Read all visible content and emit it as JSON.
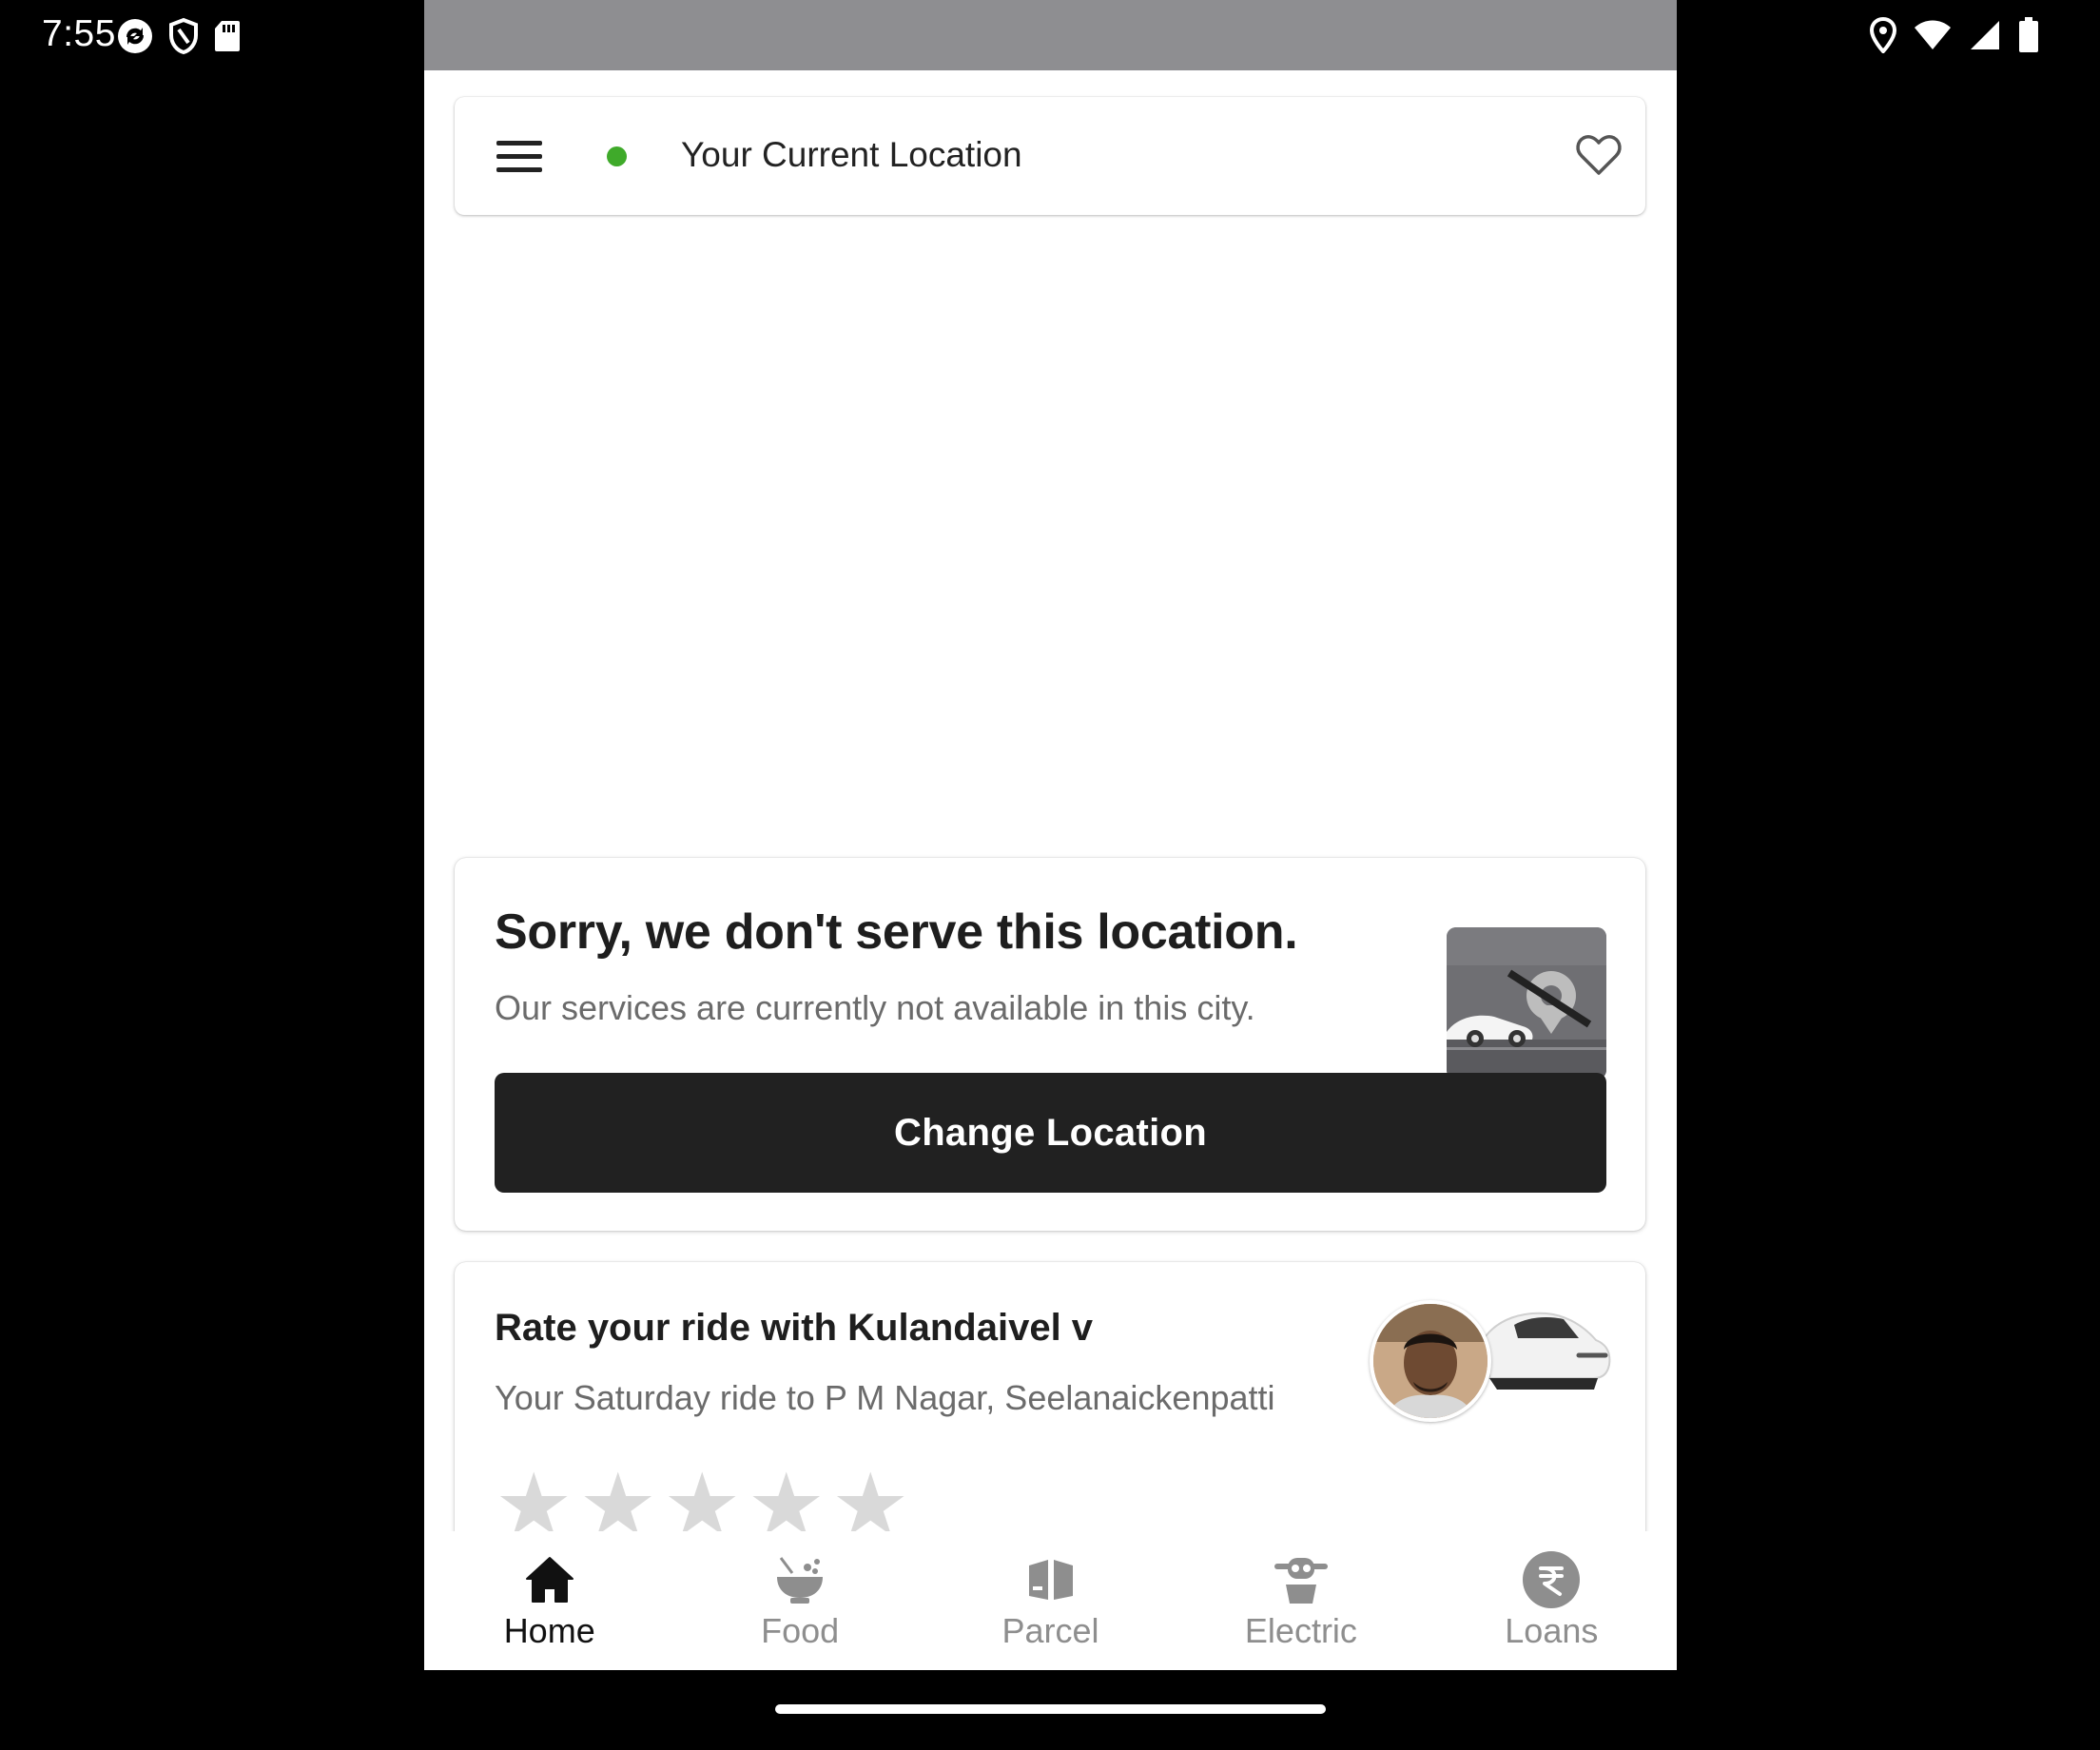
{
  "status_bar": {
    "time": "7:55",
    "left_icons": [
      "sync-icon",
      "shield-icon",
      "sd-card-icon"
    ],
    "right_icons": [
      "location-pin-icon",
      "wifi-icon",
      "cell-signal-icon",
      "battery-icon"
    ]
  },
  "header": {
    "location_label": "Your Current Location",
    "status_color": "#3faa2a"
  },
  "unserved_card": {
    "title": "Sorry, we don't serve this location.",
    "subtitle": "Our services are currently not available in this city.",
    "button_label": "Change Location"
  },
  "rate_card": {
    "title": "Rate your ride with Kulandaivel v",
    "subtitle": "Your Saturday ride to P M Nagar, Seelanaickenpatti",
    "star_count": 5,
    "rating": 0
  },
  "bottom_nav": {
    "items": [
      {
        "label": "Home",
        "icon": "home-icon",
        "active": true
      },
      {
        "label": "Food",
        "icon": "food-bowl-icon",
        "active": false
      },
      {
        "label": "Parcel",
        "icon": "parcel-box-icon",
        "active": false
      },
      {
        "label": "Electric",
        "icon": "electric-vehicle-icon",
        "active": false
      },
      {
        "label": "Loans",
        "icon": "rupee-icon",
        "active": false
      }
    ]
  },
  "colors": {
    "button_bg": "#212121",
    "active_nav": "#111111",
    "inactive_nav": "#8e8e8e"
  }
}
